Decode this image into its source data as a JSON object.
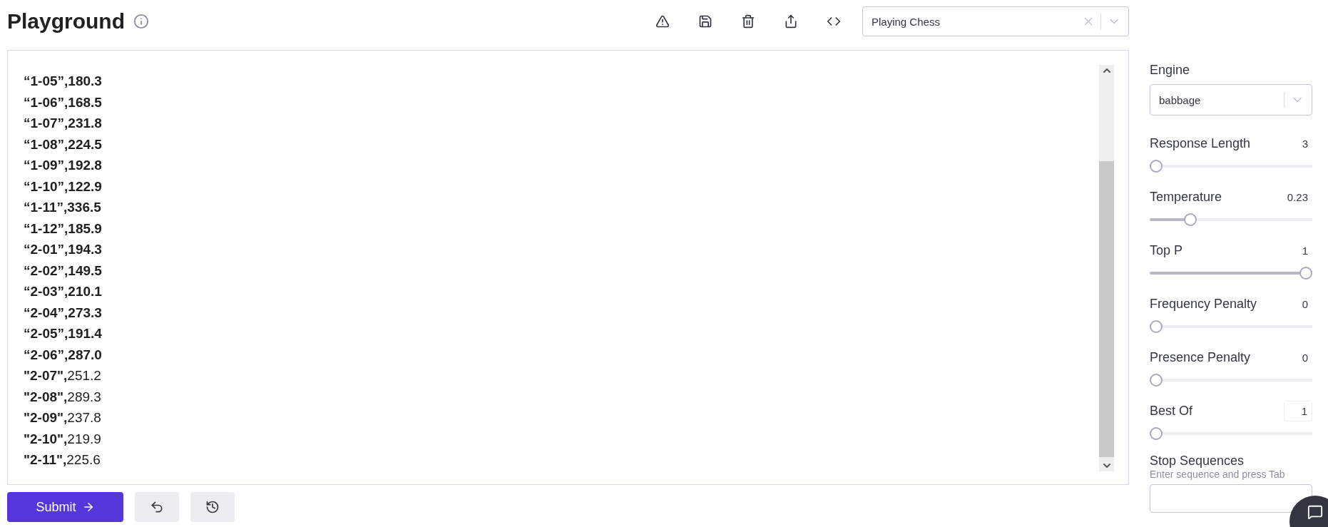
{
  "header": {
    "title": "Playground",
    "preset": {
      "value": "Playing Chess"
    }
  },
  "editor": {
    "lines": [
      {
        "key": "“1-05”",
        "value": ",180.3",
        "value_bold": true
      },
      {
        "key": "“1-06”",
        "value": ",168.5",
        "value_bold": true
      },
      {
        "key": "“1-07”",
        "value": ",231.8",
        "value_bold": true
      },
      {
        "key": "“1-08”",
        "value": ",224.5",
        "value_bold": true
      },
      {
        "key": "“1-09”",
        "value": ",192.8",
        "value_bold": true
      },
      {
        "key": "“1-10”",
        "value": ",122.9",
        "value_bold": true
      },
      {
        "key": "“1-11”",
        "value": ",336.5",
        "value_bold": true
      },
      {
        "key": "“1-12”",
        "value": ",185.9",
        "value_bold": true
      },
      {
        "key": "“2-01”",
        "value": ",194.3",
        "value_bold": true
      },
      {
        "key": "“2-02”",
        "value": ",149.5",
        "value_bold": true
      },
      {
        "key": "“2-03”",
        "value": ",210.1",
        "value_bold": true
      },
      {
        "key": "“2-04”",
        "value": ",273.3",
        "value_bold": true
      },
      {
        "key": "“2-05”",
        "value": ",191.4",
        "value_bold": true
      },
      {
        "key": "“2-06”",
        "value": ",287.0",
        "value_bold": true
      },
      {
        "key": "\"2-07\",",
        "value": "251.2",
        "value_bold": false
      },
      {
        "key": "\"2-08\",",
        "value": "289.3",
        "value_bold": false
      },
      {
        "key": "\"2-09\",",
        "value": "237.8",
        "value_bold": false
      },
      {
        "key": "\"2-10\",",
        "value": "219.9",
        "value_bold": false
      },
      {
        "key": "\"2-11\",",
        "value": "225.6",
        "value_bold": false
      }
    ]
  },
  "submit": {
    "label": "Submit"
  },
  "settings": {
    "engine": {
      "label": "Engine",
      "value": "babbage"
    },
    "parameters": [
      {
        "kind": "slider",
        "label": "Response Length",
        "reading": "3",
        "level": 0
      },
      {
        "kind": "slider",
        "label": "Temperature",
        "reading": "0.23",
        "level": 0.23
      },
      {
        "kind": "slider",
        "label": "Top P",
        "reading": "1",
        "level": 1
      },
      {
        "kind": "slider",
        "label": "Frequency Penalty",
        "reading": "0",
        "level": 0
      },
      {
        "kind": "slider",
        "label": "Presence Penalty",
        "reading": "0",
        "level": 0
      },
      {
        "kind": "boxed",
        "label": "Best Of",
        "reading": "1",
        "level": 0
      }
    ],
    "stop_sequences": {
      "label": "Stop Sequences",
      "hint": "Enter sequence and press Tab"
    }
  }
}
